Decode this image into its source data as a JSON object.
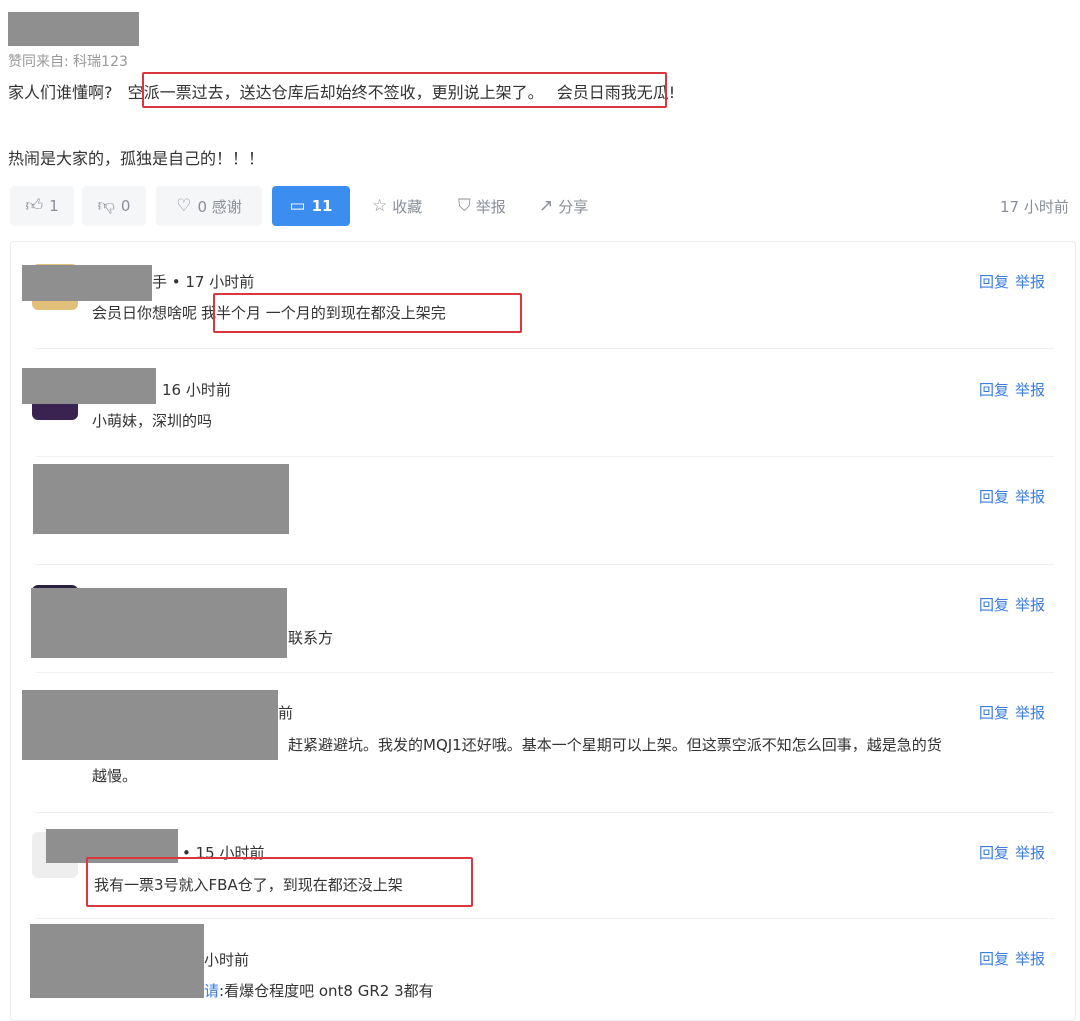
{
  "post": {
    "likes_from": "赞同来自: 科瑞123",
    "line1_prefix": "家人们谁懂啊?",
    "line1_highlight": "空派一票过去，送达仓库后却始终不签收，更别说上架了。",
    "line1_suffix": "会员日雨我无瓜!",
    "line2": "热闹是大家的，孤独是自己的！！！"
  },
  "actions": {
    "like_count": "1",
    "dislike_count": "0",
    "thanks_label": "0 感谢",
    "comments_count": "11",
    "favorite_label": "收藏",
    "report_label": "举报",
    "share_label": "分享",
    "time": "17 小时前"
  },
  "reply_labels": {
    "reply": "回复",
    "report": "举报"
  },
  "comments": [
    {
      "meta": "手 • 17 小时前",
      "text_prefix": "会员日你想啥呢",
      "text_highlight": "我半个月 一个月的到现在都没上架完"
    },
    {
      "meta": "16 小时前",
      "text": "小萌妹，深圳的吗"
    },
    {
      "meta": "",
      "text": ""
    },
    {
      "meta": "",
      "text": "联系方"
    },
    {
      "meta": "前",
      "text": "赶紧避避坑。我发的MQJ1还好哦。基本一个星期可以上架。但这票空派不知怎么回事，越是急的货",
      "text2": "越慢。"
    },
    {
      "meta": "• 15 小时前",
      "text_highlight": "我有一票3号就入FBA仓了，到现在都还没上架"
    },
    {
      "meta": "小时前",
      "text_prefix": "请",
      "text": ":看爆仓程度吧 ont8 GR2 3都有"
    }
  ],
  "colors": {
    "accent": "#3b8df0",
    "highlight_border": "#d9363e",
    "redaction": "#8f8f8f"
  }
}
